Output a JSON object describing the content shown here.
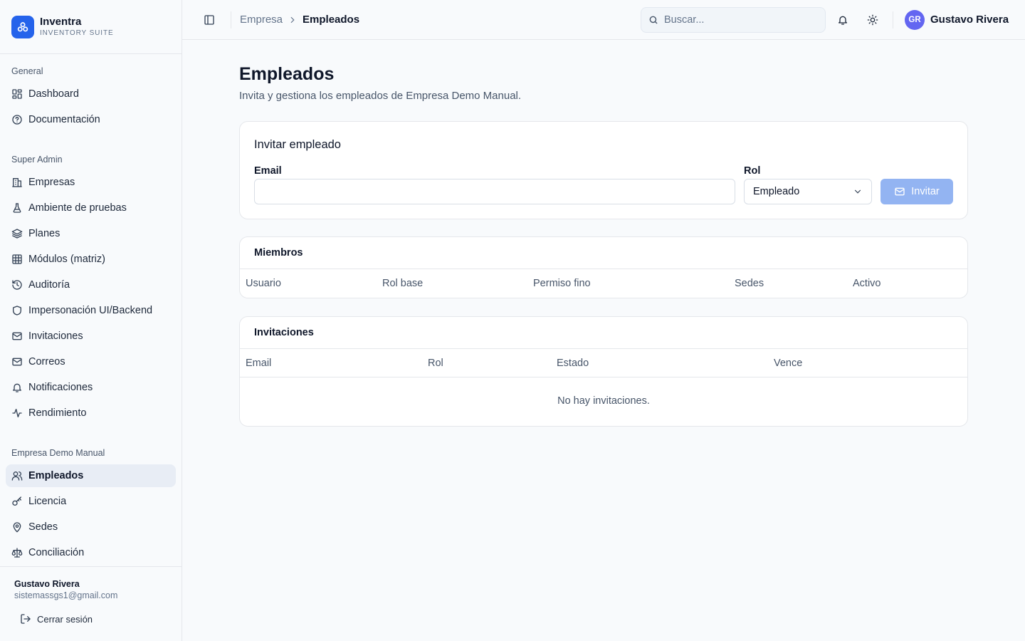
{
  "brand": {
    "name": "Inventra",
    "subtitle": "INVENTORY SUITE"
  },
  "sidebar": {
    "sections": [
      {
        "title": "General",
        "items": [
          {
            "label": "Dashboard",
            "icon": "grid-icon"
          },
          {
            "label": "Documentación",
            "icon": "help-circle-icon"
          }
        ]
      },
      {
        "title": "Super Admin",
        "items": [
          {
            "label": "Empresas",
            "icon": "building-icon"
          },
          {
            "label": "Ambiente de pruebas",
            "icon": "flask-icon"
          },
          {
            "label": "Planes",
            "icon": "layers-icon"
          },
          {
            "label": "Módulos (matriz)",
            "icon": "table-icon"
          },
          {
            "label": "Auditoría",
            "icon": "history-icon"
          },
          {
            "label": "Impersonación UI/Backend",
            "icon": "shield-icon"
          },
          {
            "label": "Invitaciones",
            "icon": "mail-icon"
          },
          {
            "label": "Correos",
            "icon": "mail-icon"
          },
          {
            "label": "Notificaciones",
            "icon": "bell-icon"
          },
          {
            "label": "Rendimiento",
            "icon": "activity-icon"
          }
        ]
      },
      {
        "title": "Empresa Demo Manual",
        "items": [
          {
            "label": "Empleados",
            "icon": "users-icon",
            "active": true
          },
          {
            "label": "Licencia",
            "icon": "key-icon"
          },
          {
            "label": "Sedes",
            "icon": "map-pin-icon"
          },
          {
            "label": "Conciliación",
            "icon": "scale-icon"
          }
        ]
      }
    ],
    "footer": {
      "user_name": "Gustavo Rivera",
      "user_email": "sistemassgs1@gmail.com",
      "logout_label": "Cerrar sesión"
    }
  },
  "topbar": {
    "breadcrumb": [
      "Empresa",
      "Empleados"
    ],
    "search_placeholder": "Buscar...",
    "avatar_initials": "GR",
    "user_name": "Gustavo Rivera"
  },
  "page": {
    "title": "Empleados",
    "subtitle": "Invita y gestiona los empleados de Empresa Demo Manual."
  },
  "invite": {
    "title": "Invitar empleado",
    "email_label": "Email",
    "email_value": "",
    "role_label": "Rol",
    "role_value": "Empleado",
    "button_label": "Invitar"
  },
  "members": {
    "title": "Miembros",
    "columns": [
      "Usuario",
      "Rol base",
      "Permiso fino",
      "Sedes",
      "Activo"
    ],
    "rows": []
  },
  "invitations": {
    "title": "Invitaciones",
    "columns": [
      "Email",
      "Rol",
      "Estado",
      "Vence"
    ],
    "rows": [],
    "empty_text": "No hay invitaciones."
  },
  "colors": {
    "accent": "#2563eb",
    "avatar": "#6366f1",
    "invite_button_disabled": "#93b4f2",
    "active_nav_bg": "#e8edf5"
  }
}
